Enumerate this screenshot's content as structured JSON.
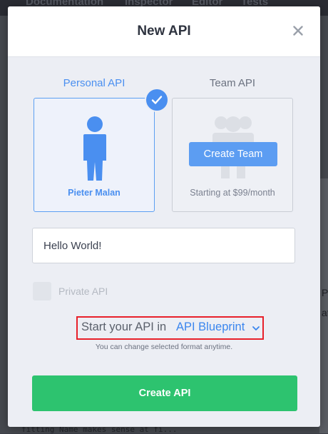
{
  "background": {
    "tabs": [
      "Documentation",
      "Inspector",
      "Editor",
      "Tests"
    ],
    "code_fragment": "fitting Name makes sense at fi..."
  },
  "modal": {
    "title": "New API",
    "close_icon": "close-icon",
    "personal": {
      "label": "Personal API",
      "owner_name": "Pieter Malan",
      "selected": true,
      "icon": "person-icon"
    },
    "team": {
      "label": "Team API",
      "button_label": "Create Team",
      "price_text": "Starting at $99/month",
      "icon": "team-icon"
    },
    "name_input": {
      "value": "Hello World!",
      "placeholder": ""
    },
    "private": {
      "label": "Private API",
      "checked": false
    },
    "format": {
      "prefix": "Start your API in",
      "selected": "API Blueprint",
      "hint": "You can change selected format anytime."
    },
    "submit_label": "Create API"
  },
  "colors": {
    "accent_blue": "#4a8ff0",
    "create_green": "#2dc36f",
    "highlight_red": "#e8202a"
  }
}
